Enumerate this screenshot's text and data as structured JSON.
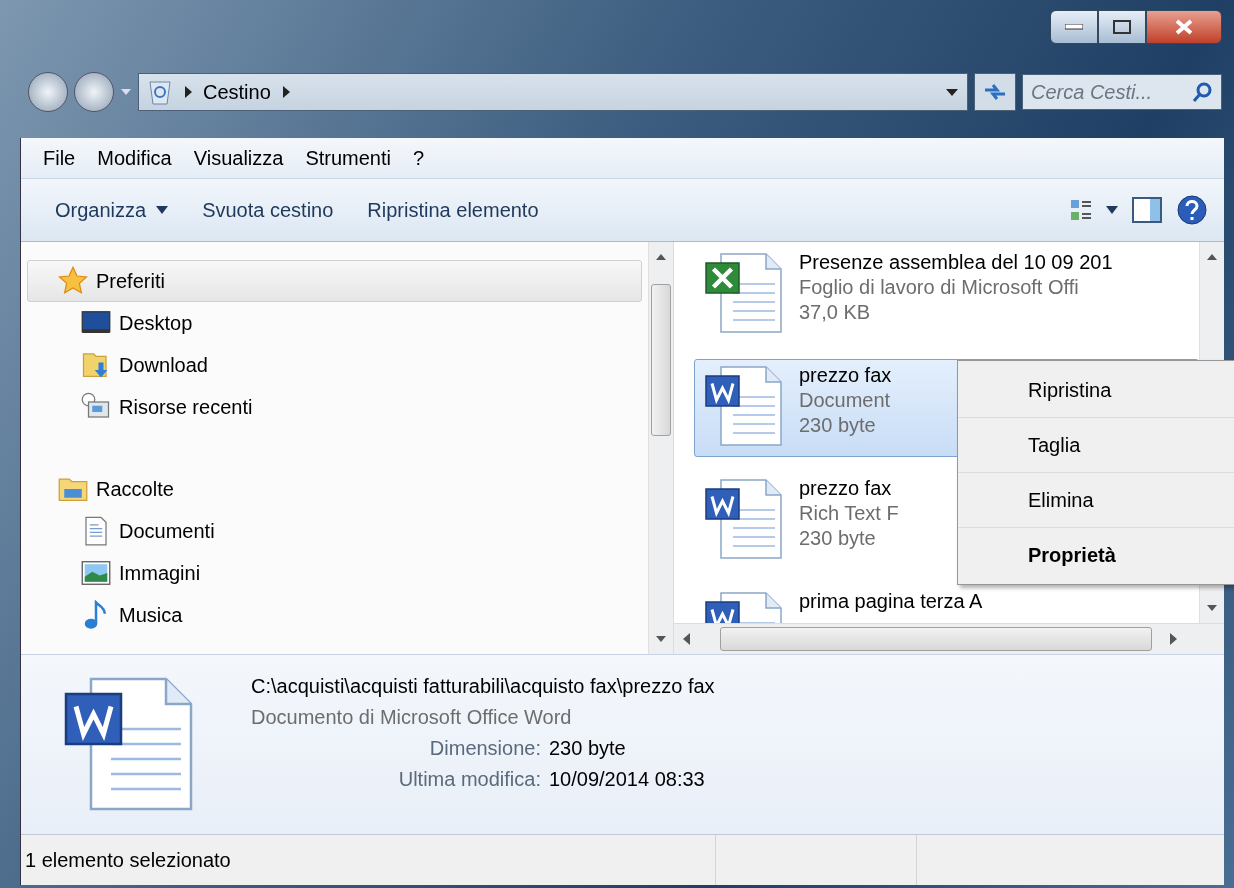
{
  "address_bar": {
    "location": "Cestino"
  },
  "search": {
    "placeholder": "Cerca Cesti..."
  },
  "menu_bar": [
    "File",
    "Modifica",
    "Visualizza",
    "Strumenti",
    "?"
  ],
  "toolbar": [
    {
      "label": "Organizza",
      "kind": "dropdown"
    },
    {
      "label": "Svuota cestino",
      "kind": "button"
    },
    {
      "label": "Ripristina elemento",
      "kind": "button"
    }
  ],
  "sidebar": {
    "groups": [
      {
        "label": "Preferiti",
        "kind": "star",
        "selected": true,
        "children": [
          {
            "label": "Desktop",
            "kind": "desktop"
          },
          {
            "label": "Download",
            "kind": "download"
          },
          {
            "label": "Risorse recenti",
            "kind": "recent"
          }
        ]
      },
      {
        "label": "Raccolte",
        "kind": "library",
        "selected": false,
        "children": [
          {
            "label": "Documenti",
            "kind": "document"
          },
          {
            "label": "Immagini",
            "kind": "image"
          },
          {
            "label": "Musica",
            "kind": "music"
          }
        ]
      }
    ]
  },
  "files": [
    {
      "name": "Presenze assemblea del 10 09 201",
      "type": "Foglio di lavoro di Microsoft Offi",
      "size": "37,0 KB",
      "kind": "excel",
      "selected": false
    },
    {
      "name": "prezzo fax",
      "type": "Document",
      "size": "230 byte",
      "kind": "word",
      "selected": true
    },
    {
      "name": "prezzo fax",
      "type": "Rich Text F",
      "size": "230 byte",
      "kind": "word",
      "selected": false
    },
    {
      "name": "prima pagina terza A",
      "kind": "word",
      "selected": false
    }
  ],
  "context_menu": [
    {
      "label": "Ripristina",
      "default": false
    },
    {
      "label": "Taglia",
      "default": false
    },
    {
      "label": "Elimina",
      "default": false
    },
    {
      "label": "Proprietà",
      "default": true
    }
  ],
  "details": {
    "path": "C:\\acquisti\\acquisti fatturabili\\acquisto fax\\prezzo fax",
    "type": "Documento di Microsoft Office Word",
    "fields": [
      {
        "label": "Dimensione:",
        "value": "230 byte"
      },
      {
        "label": "Ultima modifica:",
        "value": "10/09/2014 08:33"
      }
    ]
  },
  "status_bar": {
    "text": "1 elemento selezionato"
  }
}
